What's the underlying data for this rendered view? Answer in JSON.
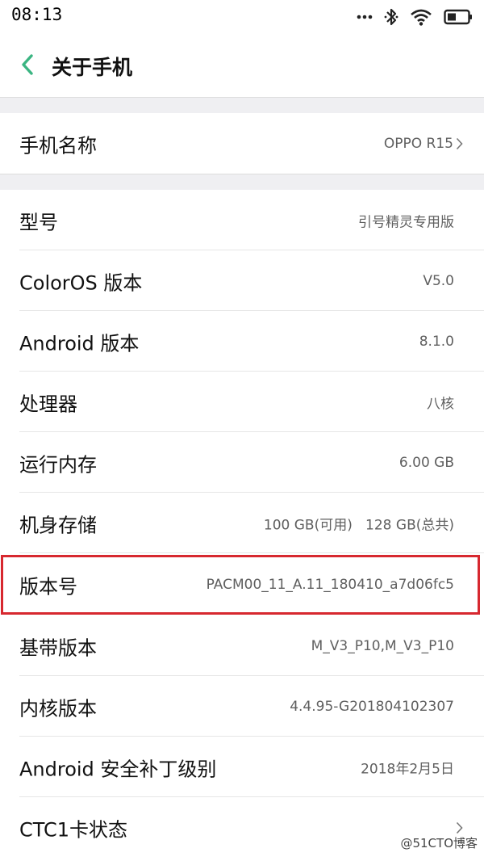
{
  "status_bar": {
    "time": "08:13",
    "icons": [
      "more-dots-icon",
      "bluetooth-icon",
      "wifi-icon",
      "battery-icon"
    ]
  },
  "header": {
    "title": "关于手机",
    "back_icon": "chevron-left-icon",
    "accent_color": "#3bb582"
  },
  "phone_name": {
    "label": "手机名称",
    "value": "OPPO R15"
  },
  "info_rows": [
    {
      "label": "型号",
      "value": "引号精灵专用版"
    },
    {
      "label": "ColorOS 版本",
      "value": "V5.0"
    },
    {
      "label": "Android 版本",
      "value": "8.1.0"
    },
    {
      "label": "处理器",
      "value": "八核"
    },
    {
      "label": "运行内存",
      "value": "6.00 GB"
    },
    {
      "label": "机身存储",
      "value": "100 GB(可用)   128 GB(总共)"
    },
    {
      "label": "版本号",
      "value": "PACM00_11_A.11_180410_a7d06fc5"
    },
    {
      "label": "基带版本",
      "value": "M_V3_P10,M_V3_P10"
    },
    {
      "label": "内核版本",
      "value": "4.4.95-G201804102307"
    },
    {
      "label": "Android 安全补丁级别",
      "value": "2018年2月5日"
    },
    {
      "label": "CTC1卡状态",
      "value": ""
    }
  ],
  "highlight_color": "#d7282f",
  "watermark": "@51CTO博客"
}
